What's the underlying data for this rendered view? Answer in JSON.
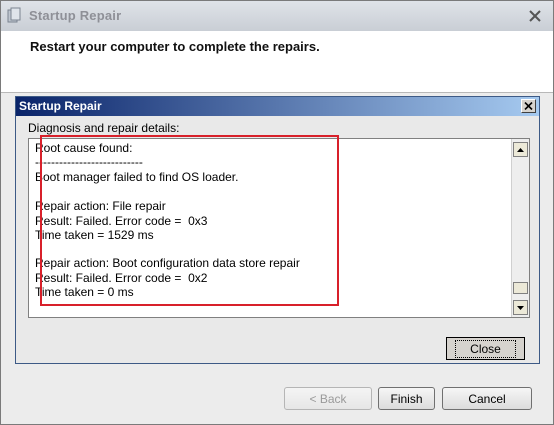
{
  "window": {
    "title": "Startup Repair",
    "header_message": "Restart your computer to complete the repairs."
  },
  "dialog": {
    "title": "Startup Repair",
    "label": "Diagnosis and repair details:",
    "details": [
      "Root cause found:",
      "---------------------------",
      "Boot manager failed to find OS loader.",
      "",
      "Repair action: File repair",
      "Result: Failed. Error code =  0x3",
      "Time taken = 1529 ms",
      "",
      "Repair action: Boot configuration data store repair",
      "Result: Failed. Error code =  0x2",
      "Time taken = 0 ms"
    ],
    "close_label": "Close",
    "highlight_color": "#d8202a"
  },
  "footer": {
    "back_label": "< Back",
    "finish_label": "Finish",
    "cancel_label": "Cancel"
  },
  "icons": {
    "app": "startup-repair-app-icon",
    "window_close": "close-icon",
    "dialog_close": "close-icon",
    "scroll_up": "arrow-up-icon",
    "scroll_down": "arrow-down-icon"
  }
}
